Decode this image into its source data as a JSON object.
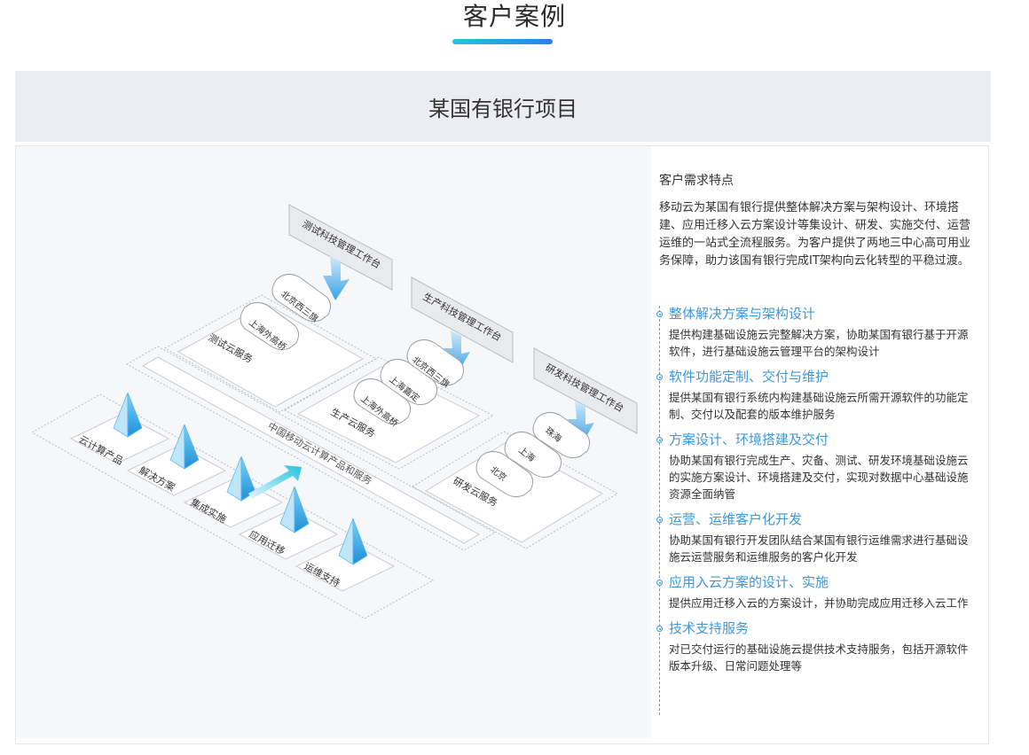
{
  "page": {
    "section_title": "客户案例",
    "case_title": "某国有银行项目"
  },
  "diagram": {
    "workbench": {
      "test": "测试科技管理工作台",
      "prod": "生产科技管理工作台",
      "dev": "研发科技管理工作台"
    },
    "clouds": {
      "test": [
        "上海外高桥",
        "北京西三旗"
      ],
      "prod": [
        "上海外高桥",
        "上海嘉定",
        "北京西三旗"
      ],
      "dev": [
        "北京",
        "上海",
        "珠海"
      ]
    },
    "services": {
      "test": "测试云服务",
      "prod": "生产云服务",
      "dev": "研发云服务"
    },
    "product_bar": "中国移动云计算产品和服务",
    "steps": [
      "云计算产品",
      "解决方案",
      "集成实施",
      "应用迁移",
      "运维支持"
    ]
  },
  "needs": {
    "title": "客户需求特点",
    "text": "移动云为某国有银行提供整体解决方案与架构设计、环境搭建、应用迁移入云方案设计等集设计、研发、实施交付、运营运维的一站式全流程服务。为客户提供了两地三中心高可用业务保障，助力该国有银行完成IT架构向云化转型的平稳过渡。"
  },
  "items": [
    {
      "title": "整体解决方案与架构设计",
      "desc": "提供构建基础设施云完整解决方案，协助某国有银行基于开源软件，进行基础设施云管理平台的架构设计"
    },
    {
      "title": "软件功能定制、交付与维护",
      "desc": "提供某国有银行系统内构建基础设施云所需开源软件的功能定制、交付以及配套的版本维护服务"
    },
    {
      "title": "方案设计、环境搭建及交付",
      "desc": "协助某国有银行完成生产、灾备、测试、研发环境基础设施云的实施方案设计、环境搭建及交付，实现对数据中心基础设施资源全面纳管"
    },
    {
      "title": "运营、运维客户化开发",
      "desc": "协助某国有银行开发团队结合某国有银行运维需求进行基础设施云运营服务和运维服务的客户化开发"
    },
    {
      "title": "应用入云方案的设计、实施",
      "desc": "提供应用迁移入云的方案设计，并协助完成应用迁移入云工作"
    },
    {
      "title": "技术支持服务",
      "desc": "对已交付运行的基础设施云提供技术支持服务，包括开源软件版本升级、日常问题处理等"
    }
  ],
  "colors": {
    "accent": "#3d97d8",
    "title_gradient_start": "#20c9d8",
    "title_gradient_end": "#2a7fe8",
    "header_bg": "#ebedf2",
    "diagram_bg": "#f6f7f9"
  }
}
